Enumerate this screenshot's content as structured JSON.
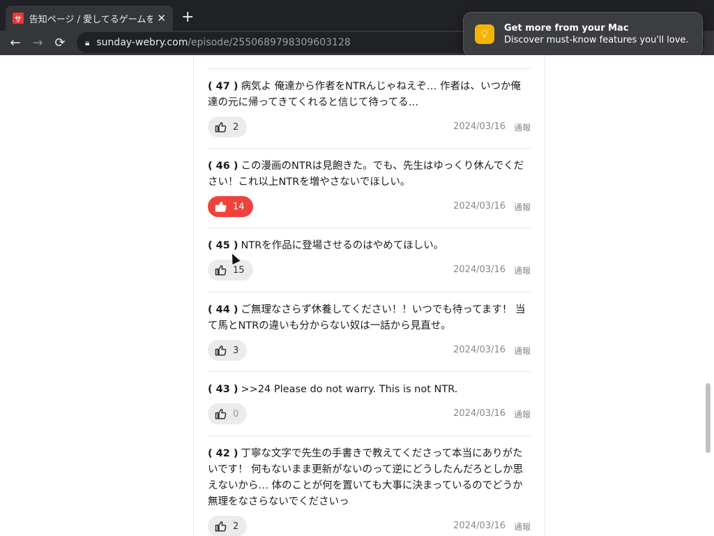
{
  "browser": {
    "tab_title": "告知ページ / 愛してるゲームを終",
    "favicon_text": "サ",
    "url_host": "sunday-webry.com",
    "url_path": "/episode/2550689798309603128"
  },
  "notification": {
    "title": "Get more from your Mac",
    "body": "Discover must-know features you'll love."
  },
  "report_label": "通報",
  "comments": [
    {
      "num": "( 47 )",
      "text": "病気よ 俺達から作者をNTRんじゃねえぞ… 作者は、いつか俺達の元に帰ってきてくれると信じて待ってる…",
      "likes": "2",
      "date": "2024/03/16"
    },
    {
      "num": "( 46 )",
      "text": "この漫画のNTRは見飽きた。でも、先生はゆっくり休んでください！これ以上NTRを増やさないでほしい。",
      "likes": "14",
      "date": "2024/03/16"
    },
    {
      "num": "( 45 )",
      "text": "NTRを作品に登場させるのはやめてほしい。",
      "likes": "15",
      "date": "2024/03/16"
    },
    {
      "num": "( 44 )",
      "text": "ご無理なさらず休養してください！！いつでも待ってます！ 当て馬とNTRの違いも分からない奴は一話から見直せ。",
      "likes": "3",
      "date": "2024/03/16"
    },
    {
      "num": "( 43 )",
      "text": ">>24 Please do not warry. This is not NTR.",
      "likes": "0",
      "date": "2024/03/16"
    },
    {
      "num": "( 42 )",
      "text": "丁寧な文字で先生の手書きで教えてくださって本当にありがたいです！ 何もないまま更新がないのって逆にどうしたんだろとしか思えないから… 体のことが何を置いても大事に決まっているのでどうか無理をなさらないでくださいっ",
      "likes": "2",
      "date": "2024/03/16"
    }
  ]
}
